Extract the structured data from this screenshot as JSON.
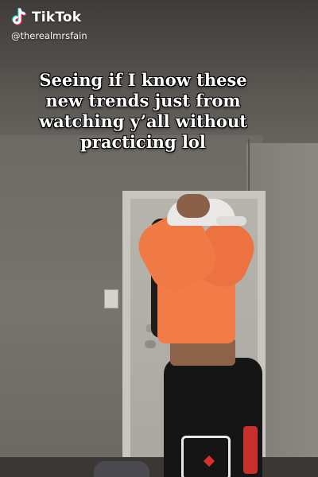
{
  "watermark": {
    "brand": "TikTok",
    "username": "@therealmrsfain",
    "logo_icon": "tiktok-note-icon",
    "colors": {
      "cyan": "#25f4ee",
      "pink": "#fe2c55",
      "white": "#ffffff"
    }
  },
  "caption": {
    "lines": [
      "Seeing if I know these",
      "new trends just from",
      "watching y’all without",
      "practicing lol"
    ]
  },
  "scene": {
    "shirt_color": "#f27c47",
    "pants_color": "#151515",
    "cap_color": "#e9e8e6",
    "wall_color": "#77736e"
  }
}
